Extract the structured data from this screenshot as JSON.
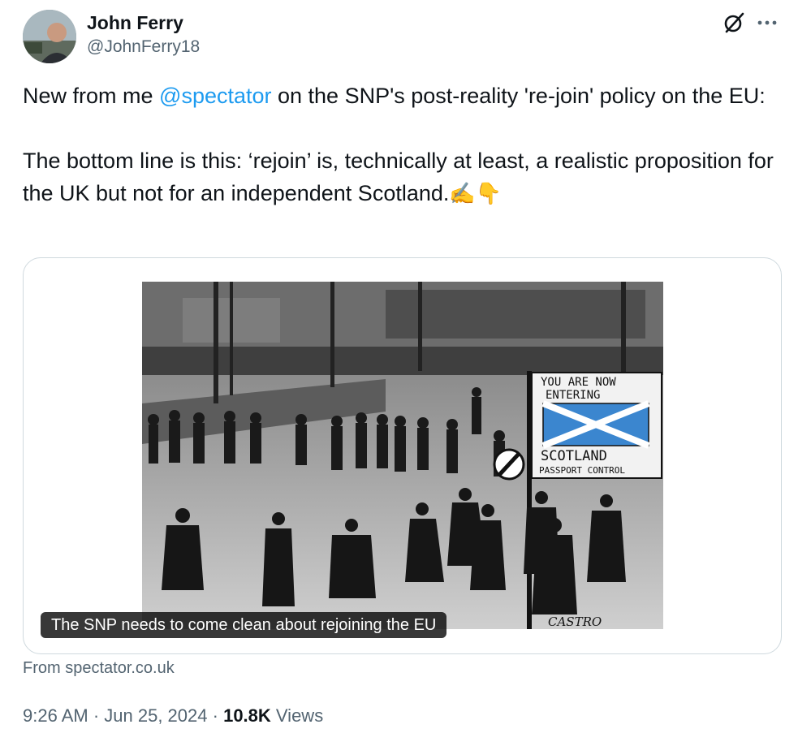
{
  "author": {
    "name": "John Ferry",
    "handle": "@JohnFerry18"
  },
  "tweet": {
    "line1_before": "New from me ",
    "mention": "@spectator",
    "line1_after": " on the SNP's post-reality 're-join' policy on the EU:",
    "line2": "The bottom line is this: ‘rejoin’ is, technically at least, a realistic proposition for the UK but not for an independent Scotland.",
    "emojis": "✍️👇"
  },
  "card": {
    "caption": "The SNP needs to come clean about rejoining the EU",
    "image": {
      "sign_line1": "YOU ARE NOW",
      "sign_line2": "ENTERING",
      "sign_line3": "SCOTLAND",
      "sign_line4": "PASSPORT CONTROL",
      "signature": "CASTRO"
    }
  },
  "source": "From spectator.co.uk",
  "meta": {
    "time": "9:26 AM",
    "sep1": " · ",
    "date": "Jun 25, 2024",
    "sep2": " · ",
    "views_count": "10.8K",
    "views_label": " Views"
  },
  "icons": {
    "grok": "grok-icon",
    "more": "more-icon"
  },
  "colors": {
    "link": "#1d9bf0",
    "secondary": "#536471",
    "text": "#0f1419",
    "flag_blue": "#3b86cf"
  }
}
